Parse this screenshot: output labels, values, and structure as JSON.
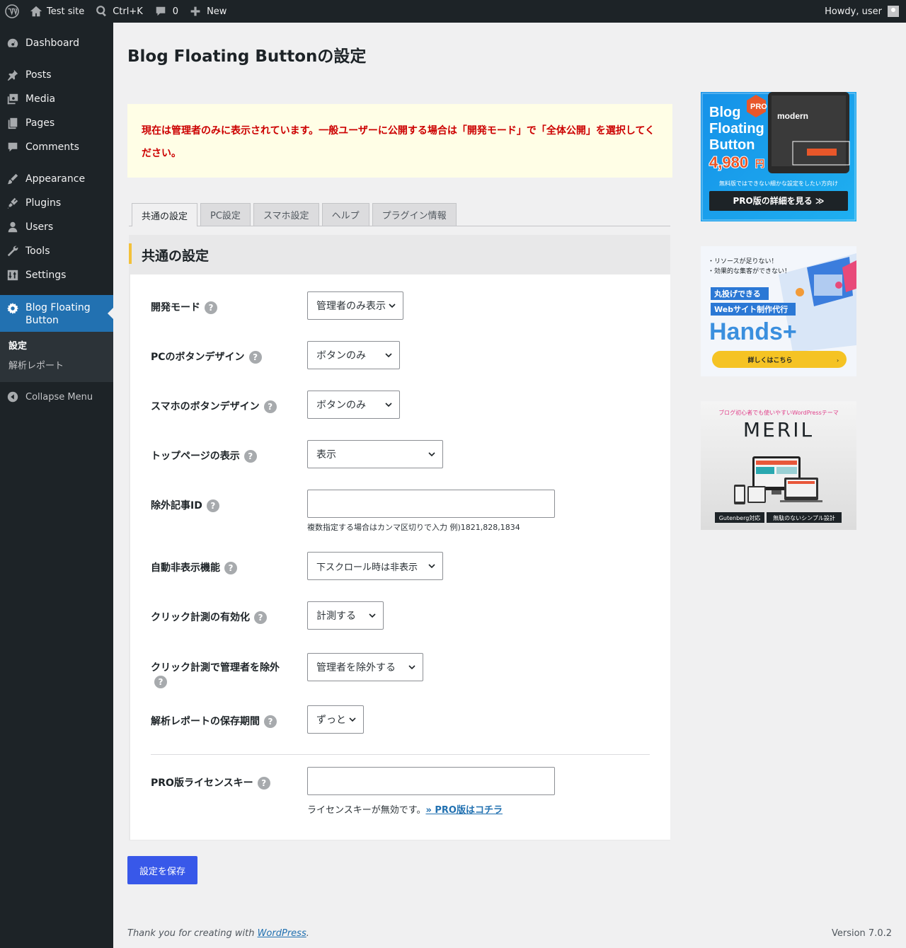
{
  "adminbar": {
    "site_name": "Test site",
    "search_shortcut": "Ctrl+K",
    "comments_count": "0",
    "new_label": "New",
    "howdy": "Howdy, user"
  },
  "sidebar": {
    "items": [
      {
        "label": "Dashboard",
        "icon": "dashboard-icon"
      },
      {
        "label": "Posts",
        "icon": "pin-icon"
      },
      {
        "label": "Media",
        "icon": "media-icon"
      },
      {
        "label": "Pages",
        "icon": "pages-icon"
      },
      {
        "label": "Comments",
        "icon": "comment-icon"
      },
      {
        "label": "Appearance",
        "icon": "brush-icon"
      },
      {
        "label": "Plugins",
        "icon": "plugin-icon"
      },
      {
        "label": "Users",
        "icon": "user-icon"
      },
      {
        "label": "Tools",
        "icon": "wrench-icon"
      },
      {
        "label": "Settings",
        "icon": "settings-icon"
      }
    ],
    "current": {
      "label_line1": "Blog Floating",
      "label_line2": "Button",
      "icon": "gear-icon"
    },
    "submenu": [
      "設定",
      "解析レポート"
    ],
    "collapse": "Collapse Menu"
  },
  "main": {
    "title": "Blog Floating Buttonの設定",
    "notice_line1": "現在は管理者のみに表示されています。一般ユーザーに公開する場合は「開発モード」で「全体公開」を選択してく",
    "notice_line2": "ださい。",
    "tabs": [
      "共通の設定",
      "PC設定",
      "スマホ設定",
      "ヘルプ",
      "プラグイン情報"
    ],
    "section_title": "共通の設定",
    "fields": [
      {
        "label": "開発モード",
        "value": "管理者のみ表示"
      },
      {
        "label": "PCのボタンデザイン",
        "value": "ボタンのみ"
      },
      {
        "label": "スマホのボタンデザイン",
        "value": "ボタンのみ"
      },
      {
        "label": "トップページの表示",
        "value": "表示"
      },
      {
        "label": "除外記事ID",
        "value": "",
        "hint": "複数指定する場合はカンマ区切りで入力 例)1821,828,1834"
      },
      {
        "label": "自動非表示機能",
        "value": "下スクロール時は非表示"
      },
      {
        "label": "クリック計測の有効化",
        "value": "計測する"
      },
      {
        "label": "クリック計測で管理者を除外",
        "value": "管理者を除外する"
      },
      {
        "label": "解析レポートの保存期間",
        "value": "ずっと"
      },
      {
        "label": "PRO版ライセンスキー",
        "value": "",
        "hint": "ライセンスキーが無効です。",
        "link": "» PRO版はコチラ"
      }
    ],
    "help_glyph": "?",
    "save_label": "設定を保存"
  },
  "footer": {
    "thanks": "Thank you for creating with ",
    "wp_link": "WordPress",
    "period": ".",
    "version": "Version 7.0.2"
  },
  "banners": {
    "pro": {
      "title1": "Blog",
      "title2": "Floating",
      "title3": "Button",
      "badge": "PRO",
      "price": "4,980",
      "yen": "円",
      "tagline": "無料版ではできない細かな設定をしたい方向け",
      "cta": "PRO版の詳細を見る ≫",
      "mock_title": "modern"
    },
    "hands": {
      "line1": "・リソースが足りない！",
      "line2": "・効果的な集客ができない！",
      "tag1": "丸投げできる",
      "tag2": "Webサイト制作代行",
      "logo": "Hands+",
      "cta": "詳しくはこちら"
    },
    "meril": {
      "tagline": "ブログ初心者でも使いやすいWordPressテーマ",
      "logo": "MERIL",
      "tag1": "Gutenberg対応",
      "tag2": "無駄のないシンプル設計"
    }
  },
  "colors": {
    "adminbar_bg": "#1d2327",
    "accent": "#2271b1",
    "save_button": "#3858e9",
    "notice_text": "#cc0000",
    "notice_bg": "#fffee6",
    "section_marker": "#f3c13a"
  }
}
